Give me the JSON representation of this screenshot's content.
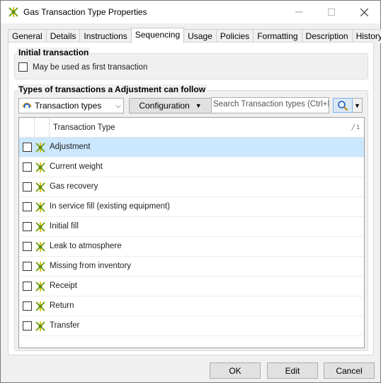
{
  "window": {
    "title": "Gas Transaction Type Properties",
    "icon": "transaction-type-icon"
  },
  "tabs": [
    {
      "label": "General",
      "active": false
    },
    {
      "label": "Details",
      "active": false
    },
    {
      "label": "Instructions",
      "active": false
    },
    {
      "label": "Sequencing",
      "active": true
    },
    {
      "label": "Usage",
      "active": false
    },
    {
      "label": "Policies",
      "active": false
    },
    {
      "label": "Formatting",
      "active": false
    },
    {
      "label": "Description",
      "active": false
    },
    {
      "label": "History",
      "active": false
    }
  ],
  "initial": {
    "group_label": "Initial transaction",
    "checkbox_label": "May be used as first transaction",
    "checked": false
  },
  "follow": {
    "group_label": "Types of transactions a Adjustment can follow",
    "dropdown_value": "Transaction types",
    "configuration_label": "Configuration",
    "search_placeholder": "Search Transaction types  (Ctrl+F",
    "column_header": "Transaction Type",
    "sort_indicator": "╱ 1",
    "rows": [
      {
        "label": "Adjustment",
        "checked": false,
        "selected": true
      },
      {
        "label": "Current weight",
        "checked": false,
        "selected": false
      },
      {
        "label": "Gas recovery",
        "checked": false,
        "selected": false
      },
      {
        "label": "In service fill (existing equipment)",
        "checked": false,
        "selected": false
      },
      {
        "label": "Initial fill",
        "checked": false,
        "selected": false
      },
      {
        "label": "Leak to atmosphere",
        "checked": false,
        "selected": false
      },
      {
        "label": "Missing from inventory",
        "checked": false,
        "selected": false
      },
      {
        "label": "Receipt",
        "checked": false,
        "selected": false
      },
      {
        "label": "Return",
        "checked": false,
        "selected": false
      },
      {
        "label": "Transfer",
        "checked": false,
        "selected": false
      }
    ]
  },
  "buttons": {
    "ok": "OK",
    "edit": "Edit",
    "cancel": "Cancel"
  },
  "colors": {
    "selection": "#cce8ff",
    "icon_green": "#7aa81e",
    "icon_yellow": "#e8c21a",
    "search_button": "#dbe9f7"
  }
}
